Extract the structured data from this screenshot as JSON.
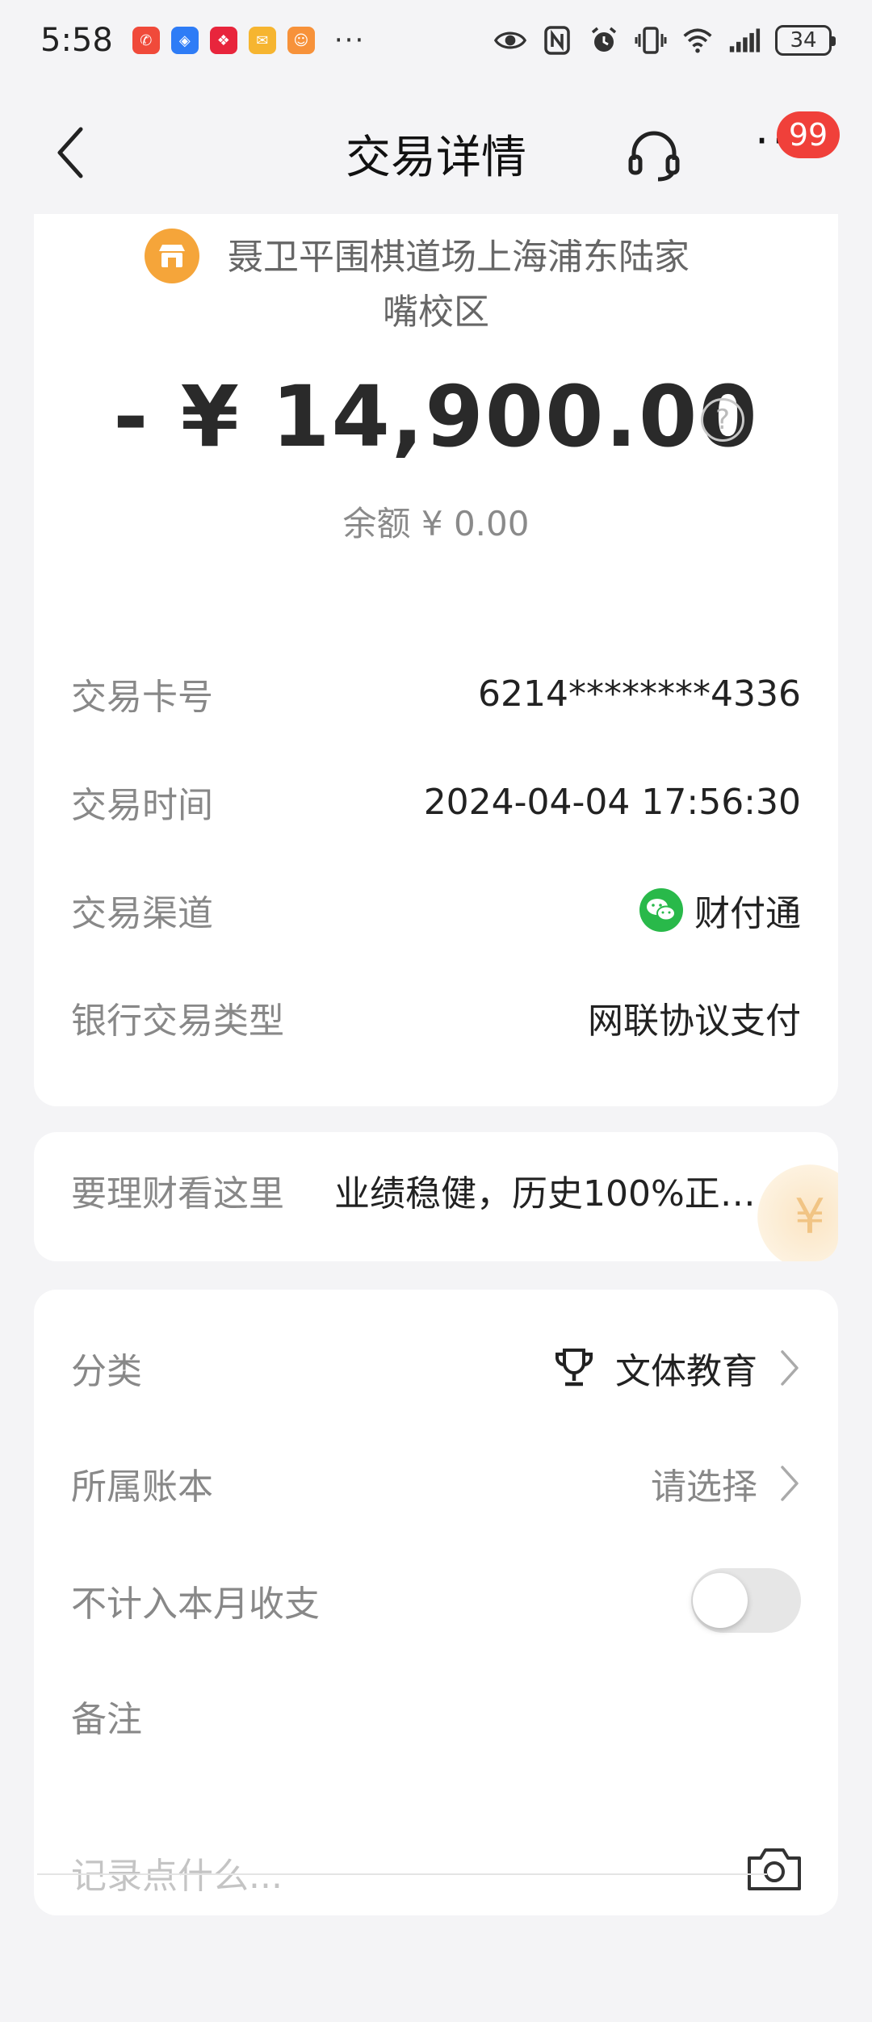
{
  "status_bar": {
    "time": "5:58",
    "battery": "34",
    "more": "···"
  },
  "nav": {
    "title": "交易详情",
    "badge": "99",
    "more": "···"
  },
  "merchant": {
    "name_line1": "聂卫平围棋道场上海浦东陆家",
    "name_line2": "嘴校区"
  },
  "amount": "- ¥ 14,900.00",
  "balance": "余额 ¥ 0.00",
  "details": [
    {
      "label": "交易卡号",
      "value": "6214********4336"
    },
    {
      "label": "交易时间",
      "value": "2024-04-04 17:56:30"
    },
    {
      "label": "交易渠道",
      "value": "财付通"
    },
    {
      "label": "银行交易类型",
      "value": "网联协议支付"
    }
  ],
  "promo": {
    "label": "要理财看这里",
    "text": "业绩稳健，历史100%正…"
  },
  "settings": {
    "category_label": "分类",
    "category_value": "文体教育",
    "ledger_label": "所属账本",
    "ledger_value": "请选择",
    "exclude_label": "不计入本月收支",
    "exclude_on": false,
    "note_label": "备注",
    "note_placeholder": "记录点什么..."
  },
  "colors": {
    "badge": "#f0403a",
    "merchant_icon": "#f5a53a",
    "wechat": "#29b94a"
  }
}
